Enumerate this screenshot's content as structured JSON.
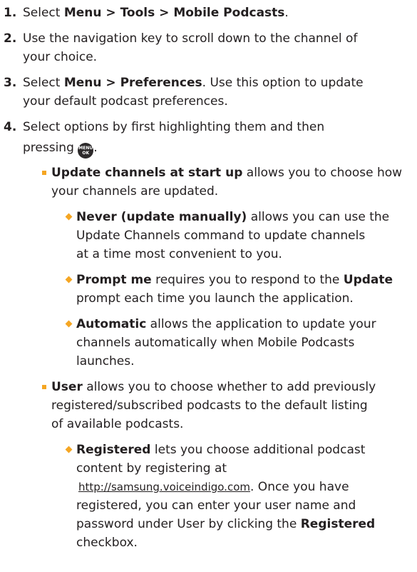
{
  "steps": {
    "s1": {
      "num": "1.",
      "pre": "Select ",
      "bold": "Menu > Tools > Mobile Podcasts",
      "post": "."
    },
    "s2": {
      "num": "2.",
      "l1": "Use the navigation key to scroll down to the channel of",
      "l2": "your choice."
    },
    "s3": {
      "num": "3.",
      "pre": "Select ",
      "bold": "Menu > Preferences",
      "post": ". Use this option to update",
      "l2": "your default podcast preferences."
    },
    "s4": {
      "num": "4.",
      "l1": "Select options by first highlighting them and then",
      "l2pre": "pressing",
      "l2post": ".",
      "key_top": "MENU",
      "key_bottom": "OK"
    }
  },
  "update": {
    "bold": "Update channels at start up",
    "l1": " allows you to choose how",
    "l2": "your channels are updated.",
    "never": {
      "bold": "Never (update manually)",
      "l1": " allows you can use the",
      "l2": "Update Channels command to update channels",
      "l3": "at a time most convenient to you."
    },
    "prompt": {
      "bold": "Prompt me",
      "l1": " requires you to respond to the ",
      "bold2": "Update",
      "l2": "prompt each time you launch the application."
    },
    "auto": {
      "bold": "Automatic",
      "l1": " allows the application to update your",
      "l2": "channels automatically when Mobile Podcasts",
      "l3": "launches."
    }
  },
  "user": {
    "bold": "User",
    "l1": " allows you to choose whether to add previously",
    "l2": "registered/subscribed podcasts to the default listing",
    "l3": "of available podcasts.",
    "registered": {
      "bold": "Registered",
      "l1": " lets you choose additional podcast",
      "l2": "content by registering at",
      "url": "http://samsung.voiceindigo.com",
      "l3post": ". Once you have",
      "l4": "registered, you can enter your user name and",
      "l5pre": "password under User by clicking the ",
      "l5bold": "Registered",
      "l6": "checkbox."
    }
  }
}
